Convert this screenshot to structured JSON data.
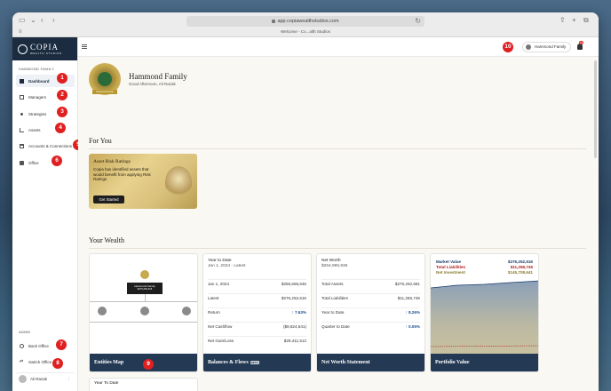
{
  "browser": {
    "url": "app.copiawealthstudios.com",
    "tab_title": "Welcome - Co...alth Studios"
  },
  "brand": {
    "name": "COPIA",
    "subtitle": "WEALTH STUDIOS"
  },
  "sidebar": {
    "family_label": "HAMMOND FAMILY",
    "items": [
      {
        "label": "Dashboard",
        "icon": "grid-icon",
        "active": true
      },
      {
        "label": "Managers",
        "icon": "id-card-icon"
      },
      {
        "label": "Strategies",
        "icon": "nodes-icon"
      },
      {
        "label": "Assets",
        "icon": "bar-chart-icon"
      },
      {
        "label": "Accounts & Connections",
        "icon": "bank-icon"
      },
      {
        "label": "Office",
        "icon": "briefcase-icon"
      }
    ],
    "admin_label": "ADMIN",
    "admin_items": [
      {
        "label": "Back Office",
        "icon": "gear-icon"
      },
      {
        "label": "Switch Office",
        "icon": "swap-icon"
      }
    ],
    "user_name": "Ali Razak"
  },
  "annotations": [
    "1",
    "2",
    "3",
    "4",
    "5",
    "6",
    "7",
    "8",
    "9",
    "10"
  ],
  "topbar": {
    "family_switch": "Hammond Family",
    "notification_count": "14"
  },
  "hero": {
    "title": "Hammond Family",
    "greeting": "Good Afternoon, Ali Razak",
    "ribbon": "Hammond Family"
  },
  "for_you": {
    "title": "For You",
    "promo": {
      "title": "Asset Risk Ratings",
      "description": "Copia has identified assets that would benefit from applying Risk Ratings",
      "button": "Get Started"
    }
  },
  "your_wealth": {
    "title": "Your Wealth",
    "entities": {
      "title": "Entities Map",
      "label": "Hammond Family",
      "value": "$276,252,616"
    },
    "balances": {
      "head": "Year to Date",
      "sub": "Jan 1, 2024 - Latest",
      "rows": [
        {
          "k": "Jan 1, 2024",
          "v": "$256,665,645"
        },
        {
          "k": "Latest",
          "v": "$276,252,616"
        },
        {
          "k": "Return",
          "v": "↑ 7.63%"
        },
        {
          "k": "Net Cashflow",
          "v": "($9,824,541)"
        },
        {
          "k": "Net Gain/Loss",
          "v": "$29,411,512"
        }
      ],
      "title": "Balances & Flows",
      "beta": "BETA"
    },
    "networth": {
      "head": "Net Worth",
      "sub": "$264,995,936",
      "rows": [
        {
          "k": "Total Assets",
          "v": "$276,252,681"
        },
        {
          "k": "Total Liabilities",
          "v": "$11,256,745"
        },
        {
          "k": "Year to Date",
          "v": "↑ 8.26%"
        },
        {
          "k": "Quarter to Date",
          "v": "↑ 0.05%"
        }
      ],
      "title": "Net Worth Statement"
    },
    "portfolio": {
      "title": "Portfolio Value",
      "legend": [
        {
          "k": "Market Value",
          "v": "$276,252,616"
        },
        {
          "k": "Total Liabilities",
          "v": "$11,256,745"
        },
        {
          "k": "Net Investment",
          "v": "$145,708,641"
        }
      ]
    }
  },
  "bottom_card": {
    "head": "Year To Date"
  }
}
